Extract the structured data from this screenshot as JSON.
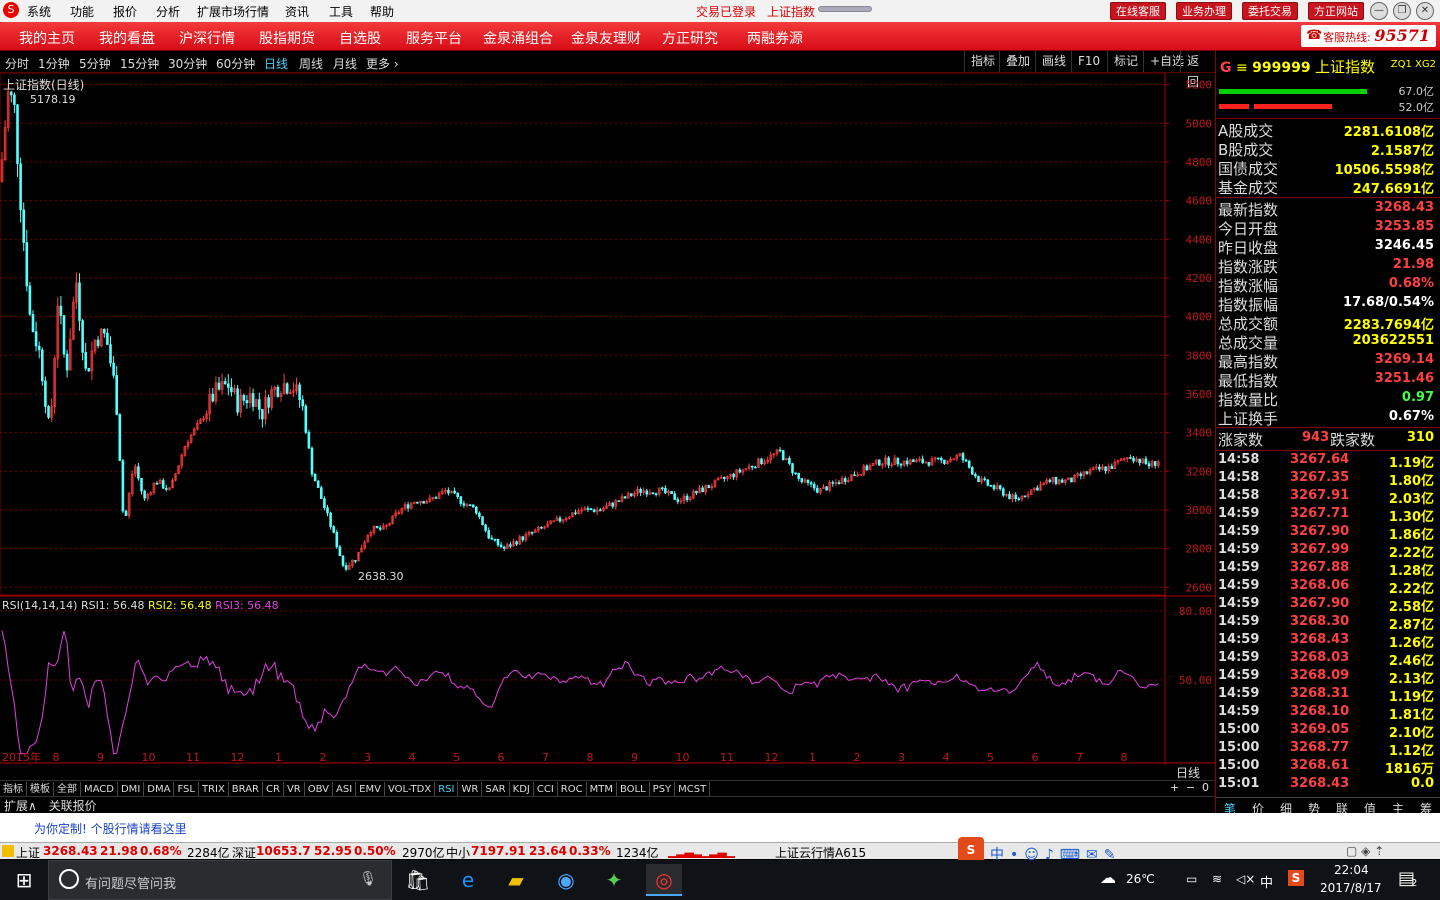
{
  "titlebar": {
    "menus": [
      "系统",
      "功能",
      "报价",
      "分析",
      "扩展市场行情",
      "资讯",
      "工具",
      "帮助"
    ],
    "login_status": "交易已登录",
    "current_index": "上证指数",
    "buttons": [
      "在线客服",
      "业务办理",
      "委托交易",
      "方正网站"
    ]
  },
  "navbar": {
    "items": [
      "我的主页",
      "我的看盘",
      "沪深行情",
      "股指期货",
      "自选股",
      "服务平台",
      "金泉涌组合",
      "金泉友理财",
      "方正研究",
      "两融券源"
    ],
    "hotline_label": "客服热线:",
    "hotline_number": "95571"
  },
  "periodbar": {
    "periods": [
      "分时",
      "1分钟",
      "5分钟",
      "15分钟",
      "30分钟",
      "60分钟",
      "日线",
      "周线",
      "月线",
      "更多 ›"
    ],
    "selected": "日线",
    "tools": [
      "指标",
      "叠加",
      "画线",
      "F10",
      "标记",
      "+自选",
      "返回"
    ]
  },
  "chart": {
    "title": "上证指数(日线)",
    "high_label": "5178.19",
    "low_label": "2638.30",
    "price_ticks": [
      "5200",
      "5000",
      "4800",
      "4600",
      "4400",
      "4200",
      "4000",
      "3800",
      "3600",
      "3400",
      "3200",
      "3000",
      "2800",
      "2600"
    ],
    "rsi_label_prefix": "RSI(14,14,14)",
    "rsi1": "RSI1: 56.48",
    "rsi2": "RSI2: 56.48",
    "rsi3": "RSI3: 56.48",
    "rsi_ticks": [
      "80.00",
      "50.00"
    ],
    "date_labels": [
      "2015年",
      "8",
      "9",
      "10",
      "11",
      "12",
      "1",
      "2",
      "3",
      "4",
      "5",
      "6",
      "7",
      "8",
      "9",
      "10",
      "11",
      "12",
      "1",
      "2",
      "3",
      "4",
      "5",
      "6",
      "7",
      "8"
    ],
    "period_tag": "日线",
    "colors": {
      "up": "#ff3c3c",
      "down": "#54ffff",
      "rsi": "#e040e0",
      "grid": "#7a0000"
    }
  },
  "bottomtabs": [
    "指标",
    "模板",
    "全部",
    "MACD",
    "DMI",
    "DMA",
    "FSL",
    "TRIX",
    "BRAR",
    "CR",
    "VR",
    "OBV",
    "ASI",
    "EMV",
    "VOL-TDX",
    "RSI",
    "WR",
    "SAR",
    "KDJ",
    "CCI",
    "ROC",
    "MTM",
    "BOLL",
    "PSY",
    "MCST"
  ],
  "bottomtabs_selected": "RSI",
  "extbar": [
    "扩展∧",
    "关联报价"
  ],
  "zoom_controls": [
    "+",
    "−",
    "0"
  ],
  "quote": {
    "header_code": "999999",
    "header_name": "上证指数",
    "header_tag": "ZQ1 XG2",
    "bar1_pct": "67.0亿",
    "bar2_pct": "52.0亿",
    "rows1": [
      {
        "label": "A股成交",
        "value": "2281.6108亿",
        "color": "#ffff00"
      },
      {
        "label": "B股成交",
        "value": "2.1587亿",
        "color": "#ffff00"
      },
      {
        "label": "国债成交",
        "value": "10506.5598亿",
        "color": "#ffff00"
      },
      {
        "label": "基金成交",
        "value": "247.6691亿",
        "color": "#ffff00"
      }
    ],
    "rows2": [
      {
        "label": "最新指数",
        "value": "3268.43",
        "color": "#ff4040"
      },
      {
        "label": "今日开盘",
        "value": "3253.85",
        "color": "#ff4040"
      },
      {
        "label": "昨日收盘",
        "value": "3246.45",
        "color": "#ffffff"
      },
      {
        "label": "指数涨跌",
        "value": "21.98",
        "color": "#ff4040"
      },
      {
        "label": "指数涨幅",
        "value": "0.68%",
        "color": "#ff4040"
      },
      {
        "label": "指数振幅",
        "value": "17.68/0.54%",
        "color": "#ffffff"
      },
      {
        "label": "总成交额",
        "value": "2283.7694亿",
        "color": "#ffff00"
      },
      {
        "label": "总成交量",
        "value": "203622551",
        "color": "#ffff00"
      },
      {
        "label": "最高指数",
        "value": "3269.14",
        "color": "#ff4040"
      },
      {
        "label": "最低指数",
        "value": "3251.46",
        "color": "#ff4040"
      },
      {
        "label": "指数量比",
        "value": "0.97",
        "color": "#40ff40"
      },
      {
        "label": "上证换手",
        "value": "0.67%",
        "color": "#ffffff"
      }
    ],
    "adv_label": "涨家数",
    "adv_value": "943",
    "dec_label": "跌家数",
    "dec_value": "310",
    "ticks": [
      {
        "t": "14:58",
        "p": "3267.64",
        "v": "1.19亿"
      },
      {
        "t": "14:58",
        "p": "3267.35",
        "v": "1.80亿"
      },
      {
        "t": "14:58",
        "p": "3267.91",
        "v": "2.03亿"
      },
      {
        "t": "14:59",
        "p": "3267.71",
        "v": "1.30亿"
      },
      {
        "t": "14:59",
        "p": "3267.90",
        "v": "1.86亿"
      },
      {
        "t": "14:59",
        "p": "3267.99",
        "v": "2.22亿"
      },
      {
        "t": "14:59",
        "p": "3267.88",
        "v": "1.28亿"
      },
      {
        "t": "14:59",
        "p": "3268.06",
        "v": "2.22亿"
      },
      {
        "t": "14:59",
        "p": "3267.90",
        "v": "2.58亿"
      },
      {
        "t": "14:59",
        "p": "3268.30",
        "v": "2.87亿"
      },
      {
        "t": "14:59",
        "p": "3268.43",
        "v": "1.26亿"
      },
      {
        "t": "14:59",
        "p": "3268.03",
        "v": "2.46亿"
      },
      {
        "t": "14:59",
        "p": "3268.09",
        "v": "2.13亿"
      },
      {
        "t": "14:59",
        "p": "3268.31",
        "v": "1.19亿"
      },
      {
        "t": "14:59",
        "p": "3268.10",
        "v": "1.81亿"
      },
      {
        "t": "15:00",
        "p": "3269.05",
        "v": "2.10亿"
      },
      {
        "t": "15:00",
        "p": "3268.77",
        "v": "1.12亿"
      },
      {
        "t": "15:00",
        "p": "3268.61",
        "v": "1816万"
      },
      {
        "t": "15:01",
        "p": "3268.43",
        "v": "0.0"
      }
    ],
    "bottom_tabs": [
      "笔",
      "价",
      "细",
      "势",
      "联",
      "值",
      "主",
      "筹"
    ]
  },
  "infostrip": {
    "link": "为你定制! 个股行情请看这里"
  },
  "ticker": {
    "sh_label": "上证",
    "sh_value": "3268.43",
    "sh_chg": "21.98",
    "sh_pct": "0.68%",
    "sh_amt": "2284亿",
    "sz_label": "深证",
    "sz_value": "10653.7",
    "sz_chg": "52.95",
    "sz_pct": "0.50%",
    "sz_amt": "2970亿",
    "zx_label": "中小",
    "zx_value": "7197.91",
    "zx_chg": "23.64",
    "zx_pct": "0.33%",
    "zx_amt": "1234亿",
    "cloud": "上证云行情A615"
  },
  "taskbar": {
    "search_placeholder": "有问题尽管问我",
    "weather": "26℃",
    "ime": "中",
    "time": "22:04",
    "date": "2017/8/17",
    "notify_count": "2"
  }
}
